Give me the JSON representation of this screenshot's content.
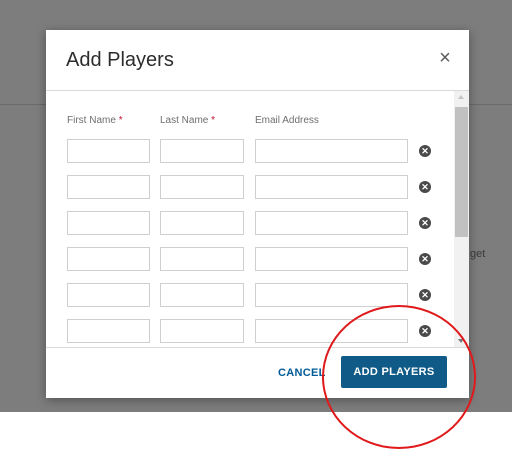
{
  "backdrop": {
    "partial_text": "get"
  },
  "modal": {
    "title": "Add Players",
    "close_glyph": "×",
    "columns": {
      "first_name": "First Name",
      "last_name": "Last Name",
      "email": "Email Address",
      "required_mark": "*"
    },
    "rows": [
      {
        "first_name": "",
        "last_name": "",
        "email": ""
      },
      {
        "first_name": "",
        "last_name": "",
        "email": ""
      },
      {
        "first_name": "",
        "last_name": "",
        "email": ""
      },
      {
        "first_name": "",
        "last_name": "",
        "email": ""
      },
      {
        "first_name": "",
        "last_name": "",
        "email": ""
      },
      {
        "first_name": "",
        "last_name": "",
        "email": ""
      }
    ],
    "remove_glyph": "✕",
    "footer": {
      "cancel_label": "CANCEL",
      "add_label": "ADD PLAYERS"
    }
  },
  "colors": {
    "primary_button": "#0f5a86",
    "link": "#005b96",
    "required": "#c8102e",
    "annotation": "#e0191b"
  }
}
